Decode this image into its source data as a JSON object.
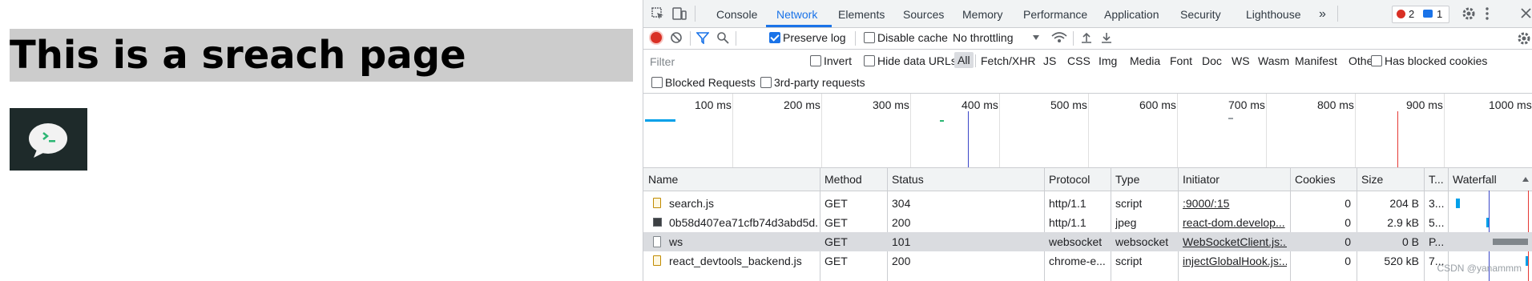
{
  "page": {
    "title": "This is a sreach page",
    "image_label": "chat-bubble-logo"
  },
  "devtools": {
    "tabs": [
      "Console",
      "Network",
      "Elements",
      "Sources",
      "Memory",
      "Performance",
      "Application",
      "Security",
      "Lighthouse"
    ],
    "active_tab": "Network",
    "more_tabs": "»",
    "error_count": "2",
    "message_count": "1",
    "toolbar": {
      "preserve_log": "Preserve log",
      "preserve_log_checked": true,
      "disable_cache": "Disable cache",
      "disable_cache_checked": false,
      "throttling": "No throttling"
    },
    "filter": {
      "placeholder": "Filter",
      "invert": "Invert",
      "hide_data_urls": "Hide data URLs",
      "types": [
        "All",
        "Fetch/XHR",
        "JS",
        "CSS",
        "Img",
        "Media",
        "Font",
        "Doc",
        "WS",
        "Wasm",
        "Manifest",
        "Other"
      ],
      "active_type": "All",
      "has_blocked_cookies": "Has blocked cookies",
      "blocked_requests": "Blocked Requests",
      "third_party": "3rd-party requests"
    },
    "overview_ticks": [
      "100 ms",
      "200 ms",
      "300 ms",
      "400 ms",
      "500 ms",
      "600 ms",
      "700 ms",
      "800 ms",
      "900 ms",
      "1000 ms"
    ],
    "columns": [
      "Name",
      "Method",
      "Status",
      "Protocol",
      "Type",
      "Initiator",
      "Cookies",
      "Size",
      "T...",
      "Waterfall"
    ],
    "requests": [
      {
        "name": "search.js",
        "method": "GET",
        "status": "304",
        "protocol": "http/1.1",
        "type": "script",
        "initiator": ":9000/:15",
        "cookies": "0",
        "size": "204 B",
        "time": "3...",
        "icon": "script-file-icon"
      },
      {
        "name": "0b58d407ea71cfb74d3abd5d...",
        "method": "GET",
        "status": "200",
        "protocol": "http/1.1",
        "type": "jpeg",
        "initiator": "react-dom.develop...",
        "cookies": "0",
        "size": "2.9 kB",
        "time": "5...",
        "icon": "image-file-icon"
      },
      {
        "name": "ws",
        "method": "GET",
        "status": "101",
        "protocol": "websocket",
        "type": "websocket",
        "initiator": "WebSocketClient.js:...",
        "cookies": "0",
        "size": "0 B",
        "time": "P...",
        "icon": "websocket-icon"
      },
      {
        "name": "react_devtools_backend.js",
        "method": "GET",
        "status": "200",
        "protocol": "chrome-e...",
        "type": "script",
        "initiator": "injectGlobalHook.js:...",
        "cookies": "0",
        "size": "520 kB",
        "time": "7...",
        "icon": "script-file-icon"
      }
    ],
    "watermark": "CSDN @yanammm"
  },
  "colors": {
    "accent": "#1a73e8",
    "record": "#d93025",
    "selected_row": "#dadce0",
    "waterfall_bar": "#00a0e9"
  }
}
